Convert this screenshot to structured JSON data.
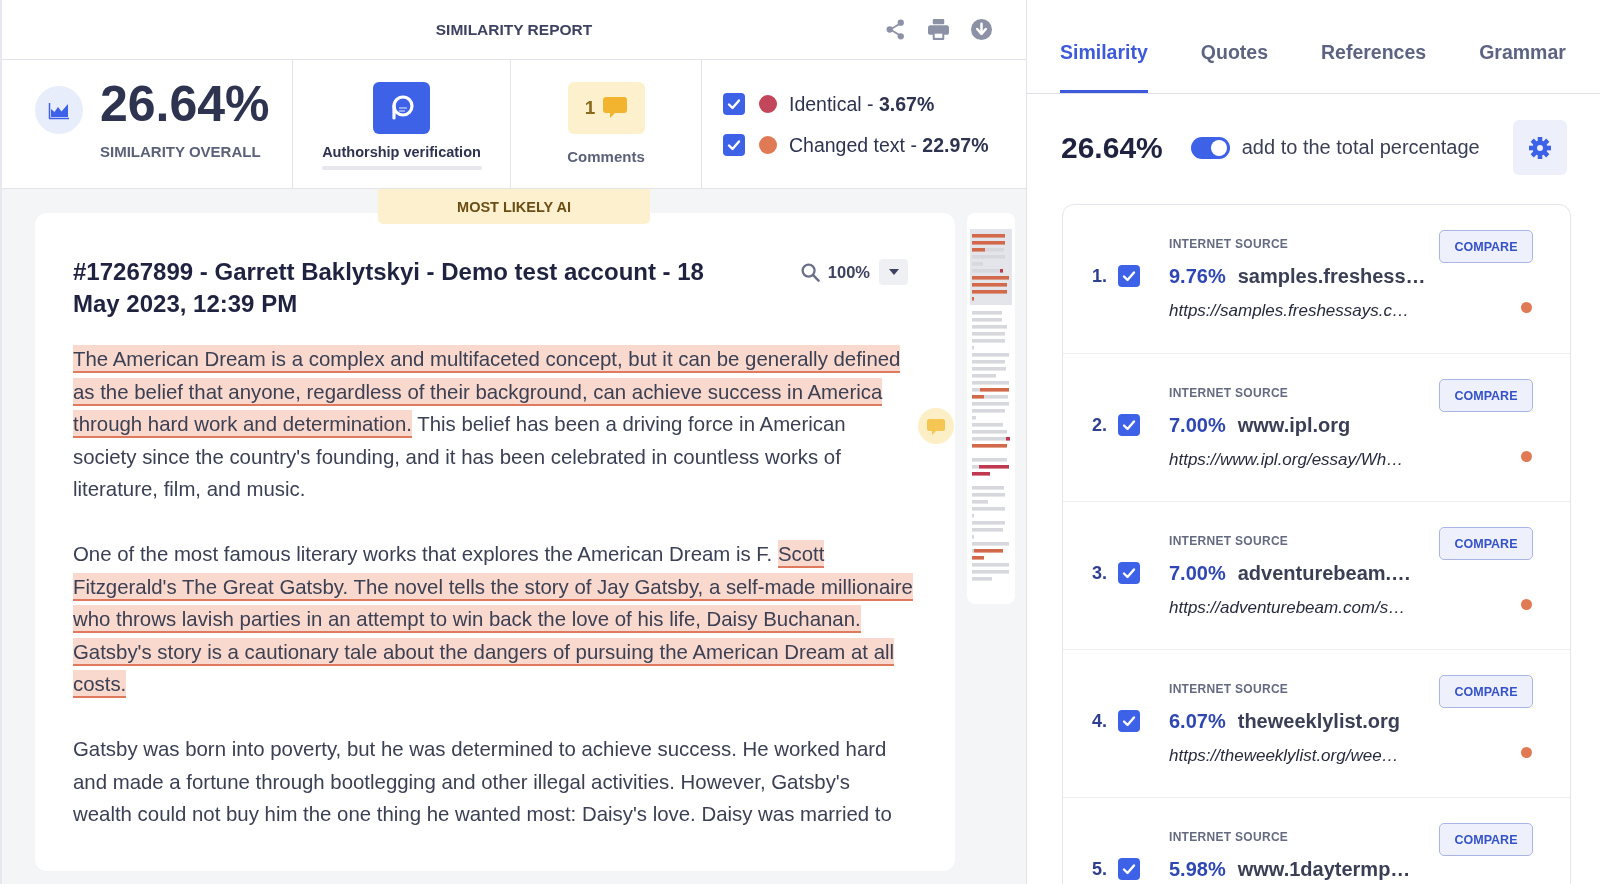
{
  "report": {
    "title": "SIMILARITY REPORT"
  },
  "summary": {
    "overall": {
      "value": "26.64%",
      "label": "SIMILARITY OVERALL"
    },
    "authorship": {
      "label": "Authorship verification",
      "level": 0
    },
    "comments": {
      "count": "1",
      "label": "Comments"
    },
    "legend": [
      {
        "text": "Identical - **3.67%**",
        "checked": true,
        "color": "#c4465a"
      },
      {
        "text": "Changed text - **22.97%**",
        "checked": true,
        "color": "#e07a55"
      }
    ]
  },
  "document": {
    "badge": "MOST LIKELY AI",
    "title": "#17267899 - Garrett Baklytskyi - Demo test account - 18 May 2023, 12:39 PM",
    "zoom": "100%",
    "paragraphs": [
      {
        "segments": [
          {
            "text": "The American Dream is a complex and multifaceted concept, but it can be generally defined as the belief that anyone, regardless of their background, can achieve success in America through hard work and determination.",
            "highlighted": true
          },
          {
            "text": " This belief has been a driving force in American society since the country's founding, and it has been celebrated in countless works of literature, film, and music.",
            "highlighted": false
          }
        ]
      },
      {
        "segments": [
          {
            "text": "One of the most famous literary works that explores the American Dream is F. ",
            "highlighted": false
          },
          {
            "text": "Scott Fitzgerald's The Great Gatsby. The novel tells the story of Jay Gatsby, a self-made millionaire who throws lavish parties in an attempt to win back the love of his life, Daisy Buchanan. Gatsby's story is a cautionary tale about the dangers of pursuing the American Dream at all costs.",
            "highlighted": true
          }
        ]
      },
      {
        "segments": [
          {
            "text": "Gatsby was born into poverty, but he was determined to achieve success. He worked hard and made a fortune through bootlegging and other illegal activities. However, Gatsby's wealth could not buy him the one thing he wanted most: Daisy's love. Daisy was married to",
            "highlighted": false
          }
        ]
      }
    ]
  },
  "sidebar": {
    "tabs": [
      {
        "label": "Similarity",
        "selected": true
      },
      {
        "label": "Quotes",
        "selected": false
      },
      {
        "label": "References",
        "selected": false
      },
      {
        "label": "Grammar",
        "selected": false
      }
    ],
    "total": "26.64%",
    "toggle": {
      "label": "add to the total percentage",
      "on": true
    },
    "sources": [
      {
        "number": "1.",
        "checked": true,
        "type": "INTERNET SOURCE",
        "percent": "9.76%",
        "domain": "samples.freshess…",
        "url": "https://samples.freshessays.c…",
        "button": "COMPARE",
        "color": "#e07a55"
      },
      {
        "number": "2.",
        "checked": true,
        "type": "INTERNET SOURCE",
        "percent": "7.00%",
        "domain": "www.ipl.org",
        "url": "https://www.ipl.org/essay/Wh…",
        "button": "COMPARE",
        "color": "#e07a55"
      },
      {
        "number": "3.",
        "checked": true,
        "type": "INTERNET SOURCE",
        "percent": "7.00%",
        "domain": "adventurebeam.…",
        "url": "https://adventurebeam.com/s…",
        "button": "COMPARE",
        "color": "#e07a55"
      },
      {
        "number": "4.",
        "checked": true,
        "type": "INTERNET SOURCE",
        "percent": "6.07%",
        "domain": "theweeklylist.org",
        "url": "https://theweeklylist.org/wee…",
        "button": "COMPARE",
        "color": "#e07a55"
      },
      {
        "number": "5.",
        "checked": true,
        "type": "INTERNET SOURCE",
        "percent": "5.98%",
        "domain": "www.1daytermp…",
        "button": "COMPARE"
      }
    ]
  }
}
